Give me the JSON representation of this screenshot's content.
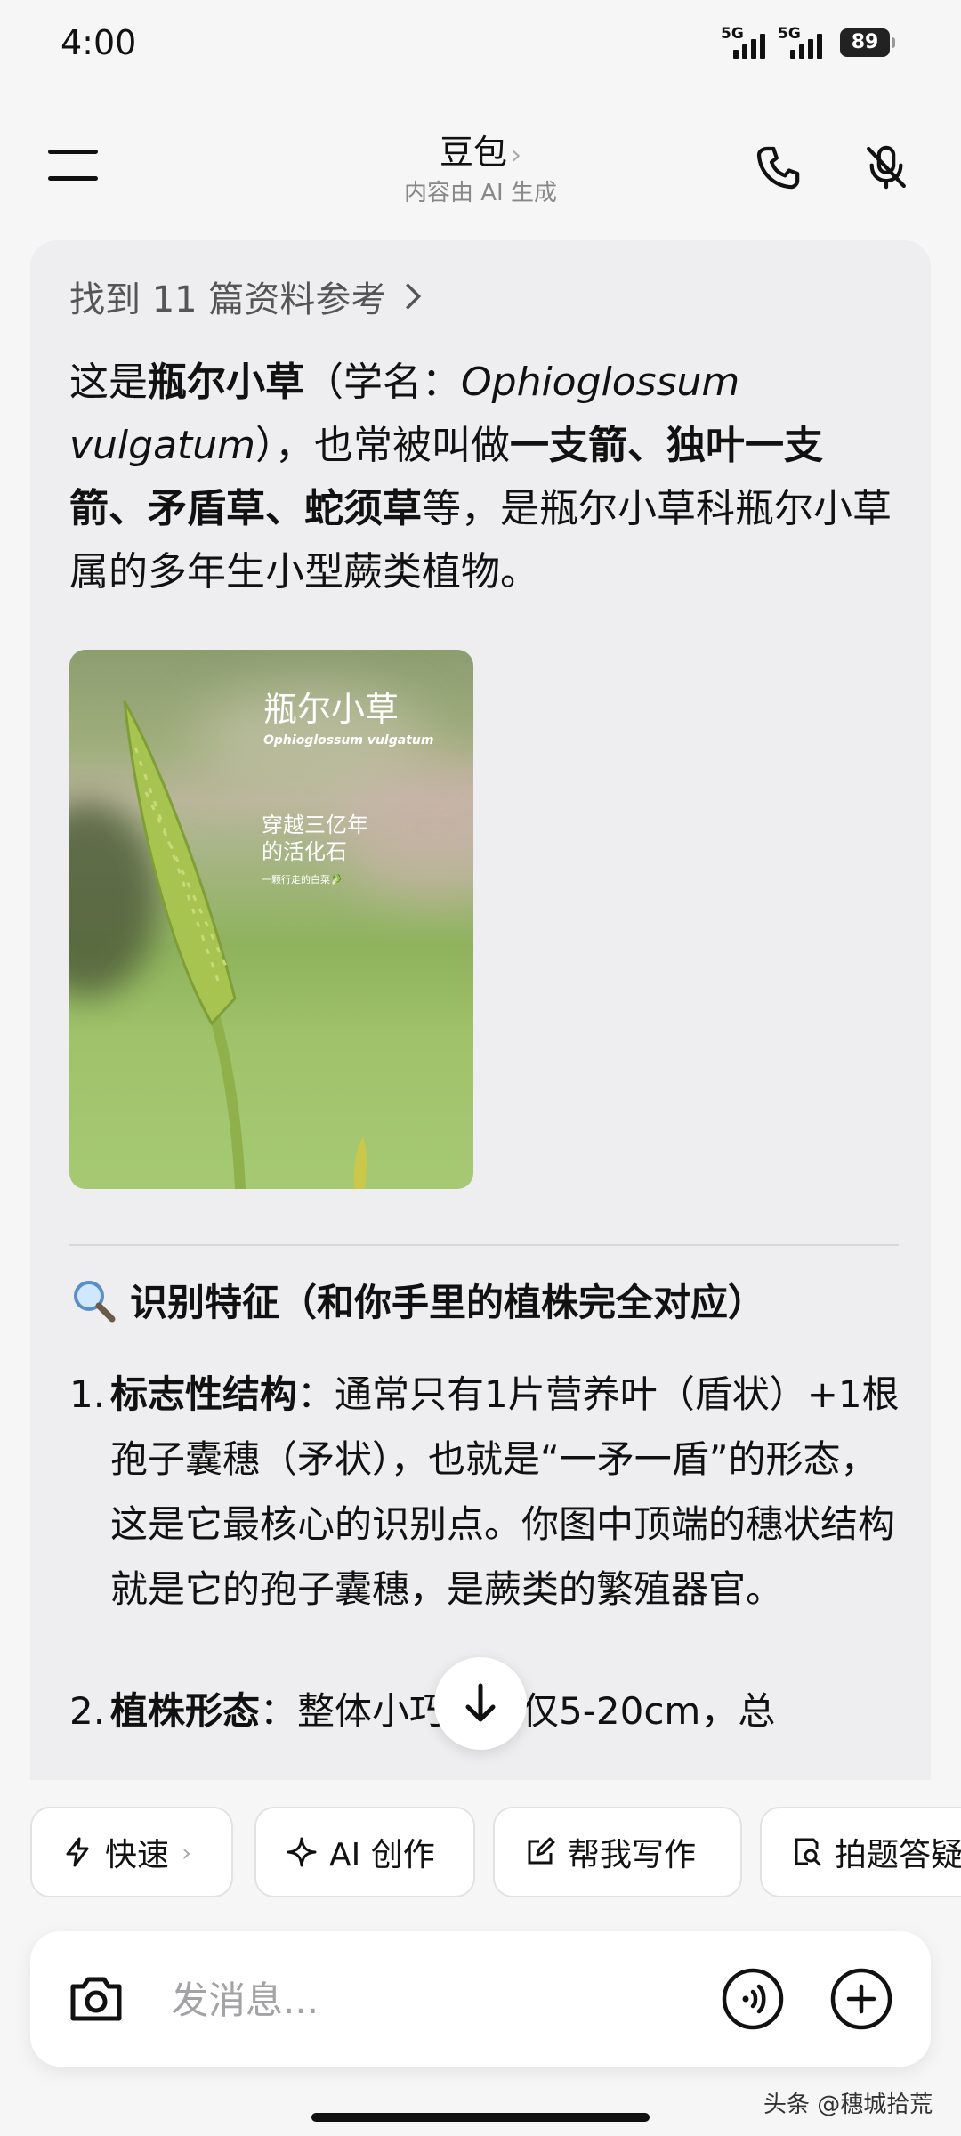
{
  "status": {
    "time": "4:00",
    "signal1": "5G",
    "signal2": "5G",
    "battery": "89"
  },
  "header": {
    "title": "豆包",
    "title_chevron": "›",
    "subtitle": "内容由 AI 生成"
  },
  "message": {
    "refs": "找到 11 篇资料参考",
    "intro_1": "这是",
    "intro_bold_1": "瓶尔小草",
    "intro_2": "（学名：",
    "intro_latin": "Ophioglossum vulgatum",
    "intro_3": "），也常被叫做",
    "intro_bold_2": "一支箭、独叶一支箭、矛盾草、蛇须草",
    "intro_4": "等，是瓶尔小草科瓶尔小草属的多年生小型蕨类植物。",
    "image": {
      "title": "瓶尔小草",
      "latin": "Ophioglossum vulgatum",
      "slogan_1": "穿越三亿年",
      "slogan_2": "的活化石",
      "credit": "一颗行走的白菜🥬"
    },
    "section_title": "识别特征（和你手里的植株完全对应）",
    "features": [
      {
        "num": "1.",
        "label": "标志性结构",
        "text": "：通常只有1片营养叶（盾状）+1根孢子囊穗（矛状），也就是“一矛一盾”的形态，这是它最核心的识别点。你图中顶端的穗状结构就是它的孢子囊穗，是蕨类的繁殖器官。"
      },
      {
        "num": "2.",
        "label": "植株形态",
        "text": "：整体小巧，高仅5-20cm，总"
      }
    ]
  },
  "chips": {
    "fast": "快速",
    "fast_chevron": "›",
    "ai": "AI 创作",
    "write": "帮我写作",
    "photo": "拍题答疑"
  },
  "input": {
    "placeholder": "发消息..."
  },
  "watermark": "头条 @穗城拾荒"
}
